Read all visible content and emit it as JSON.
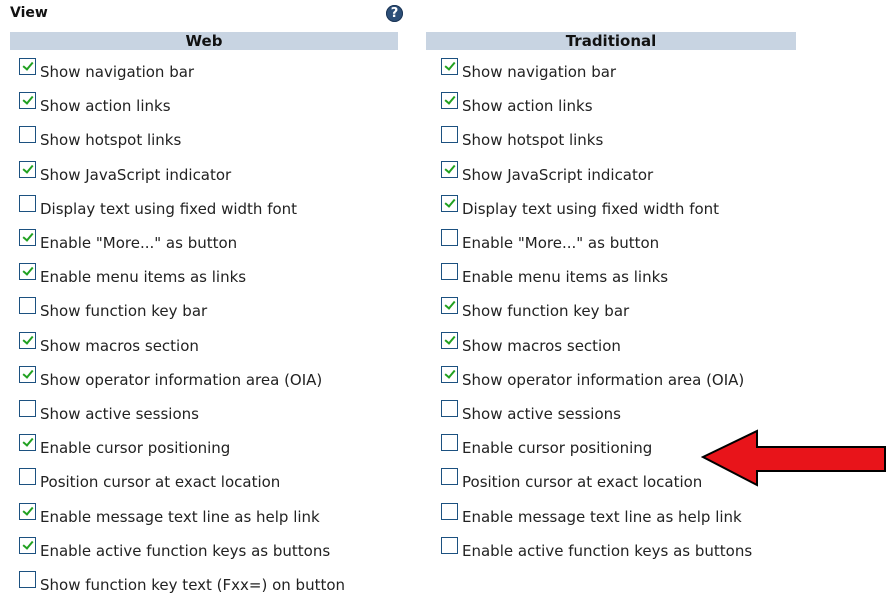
{
  "title": "View",
  "help_icon_glyph": "?",
  "web": {
    "header": "Web",
    "items": [
      {
        "label": "Show navigation bar",
        "checked": true
      },
      {
        "label": "Show action links",
        "checked": true
      },
      {
        "label": "Show hotspot links",
        "checked": false
      },
      {
        "label": "Show JavaScript indicator",
        "checked": true
      },
      {
        "label": "Display text using fixed width font",
        "checked": false
      },
      {
        "label": "Enable \"More...\" as button",
        "checked": true
      },
      {
        "label": "Enable menu items as links",
        "checked": true
      },
      {
        "label": "Show function key bar",
        "checked": false
      },
      {
        "label": "Show macros section",
        "checked": true
      },
      {
        "label": "Show operator information area (OIA)",
        "checked": true
      },
      {
        "label": "Show active sessions",
        "checked": false
      },
      {
        "label": "Enable cursor positioning",
        "checked": true
      },
      {
        "label": "Position cursor at exact location",
        "checked": false
      },
      {
        "label": "Enable message text line as help link",
        "checked": true
      },
      {
        "label": "Enable active function keys as buttons",
        "checked": true
      },
      {
        "label": "Show function key text (Fxx=) on button",
        "checked": false
      }
    ]
  },
  "traditional": {
    "header": "Traditional",
    "items": [
      {
        "label": "Show navigation bar",
        "checked": true
      },
      {
        "label": "Show action links",
        "checked": true
      },
      {
        "label": "Show hotspot links",
        "checked": false
      },
      {
        "label": "Show JavaScript indicator",
        "checked": true
      },
      {
        "label": "Display text using fixed width font",
        "checked": true
      },
      {
        "label": "Enable \"More...\" as button",
        "checked": false
      },
      {
        "label": "Enable menu items as links",
        "checked": false
      },
      {
        "label": "Show function key bar",
        "checked": true
      },
      {
        "label": "Show macros section",
        "checked": true
      },
      {
        "label": "Show operator information area (OIA)",
        "checked": true
      },
      {
        "label": "Show active sessions",
        "checked": false
      },
      {
        "label": "Enable cursor positioning",
        "checked": false
      },
      {
        "label": "Position cursor at exact location",
        "checked": false
      },
      {
        "label": "Enable message text line as help link",
        "checked": false
      },
      {
        "label": "Enable active function keys as buttons",
        "checked": false
      }
    ]
  },
  "colors": {
    "header_bg": "#c8d4e2",
    "checkbox_border": "#1c5180",
    "checkmark": "#21a121",
    "arrow_fill": "#e8141a"
  },
  "annotation": {
    "icon": "red-arrow-icon",
    "points_to": "traditional.items.11"
  }
}
